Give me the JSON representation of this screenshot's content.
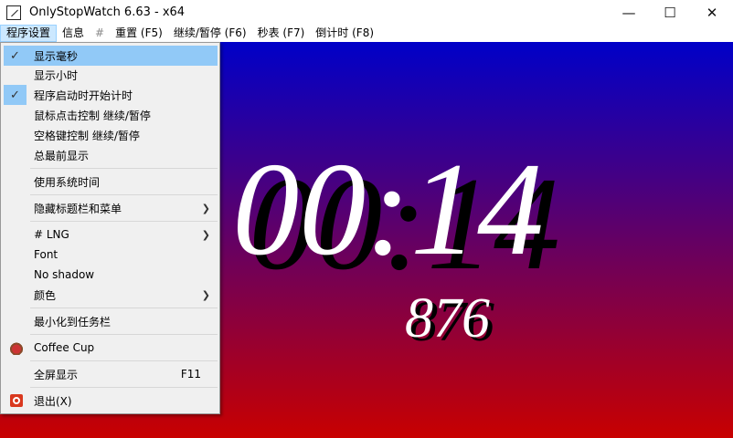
{
  "window": {
    "title": "OnlyStopWatch 6.63 - x64"
  },
  "menubar": [
    "程序设置",
    "信息",
    "#",
    "重置 (F5)",
    "继续/暂停 (F6)",
    "秒表 (F7)",
    "倒计时 (F8)"
  ],
  "menu": {
    "items": [
      {
        "label": "显示毫秒",
        "checked": true
      },
      {
        "label": "显示小时"
      },
      {
        "label": "程序启动时开始计时",
        "checked": true
      },
      {
        "label": "鼠标点击控制 继续/暂停"
      },
      {
        "label": "空格键控制 继续/暂停"
      },
      {
        "label": "总最前显示"
      },
      {
        "label": "使用系统时间"
      },
      {
        "label": "隐藏标题栏和菜单"
      },
      {
        "label": "# LNG"
      },
      {
        "label": "Font"
      },
      {
        "label": "No shadow"
      },
      {
        "label": "颜色"
      },
      {
        "label": "最小化到任务栏"
      },
      {
        "label": "Coffee Cup"
      },
      {
        "label": "全屏显示",
        "shortcut": "F11"
      },
      {
        "label": "退出(X)"
      }
    ]
  },
  "timer": {
    "time": "00:14",
    "ms": "876"
  },
  "colors": {
    "top": "#0000c8",
    "bottom": "#c80000",
    "highlight": "#91c9f7"
  }
}
